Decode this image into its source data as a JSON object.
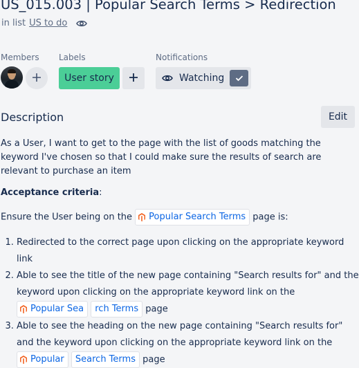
{
  "card": {
    "title": "US_015.003 | Popular Search Terms > Redirection",
    "in_list_prefix": "in list",
    "list_name": "US to do"
  },
  "sections": {
    "members_label": "Members",
    "labels_label": "Labels",
    "notifications_label": "Notifications"
  },
  "labels": [
    {
      "text": "User story",
      "color": "#4bce97"
    }
  ],
  "notifications": {
    "watch_label": "Watching",
    "watching": true
  },
  "description": {
    "heading": "Description",
    "edit_label": "Edit",
    "paragraph": "As a User, I want to get to the page with the list of goods matching the keyword I've chosen so that I could make sure the results of search are relevant to purchase an item",
    "criteria_heading": "Acceptance criteria",
    "criteria_colon": ":",
    "ensure_prefix": "Ensure the User being on the",
    "ensure_link": "Popular Search Terms",
    "ensure_suffix": "page is:",
    "items": [
      {
        "text": "Redirected to the correct page upon clicking on the appropriate keyword link"
      },
      {
        "text_before": "Able to see the title of the new page containing \"Search results for\" and the keyword upon clicking on the appropriate keyword link on the",
        "link_part1": "Popular Sea",
        "link_part2": "rch Terms",
        "text_after": "page"
      },
      {
        "text_before": "Able to see the heading on the new page containing \"Search results for\" and the keyword upon clicking on the appropriate keyword link on the",
        "link_part1": "Popular",
        "link_part2": "Search Terms",
        "text_after": "page"
      }
    ]
  },
  "icons": {
    "watch_icon": "eye-icon",
    "list_watch_icon": "eye-icon",
    "add_member": "plus-icon",
    "add_label": "plus-icon",
    "watching_state": "check-icon",
    "link_chip": "magento-logo-icon"
  },
  "colors": {
    "background": "#f4f5f7",
    "label_green": "#4bce97",
    "link_blue": "#0c66e4",
    "check_bg": "#5e6c84"
  }
}
